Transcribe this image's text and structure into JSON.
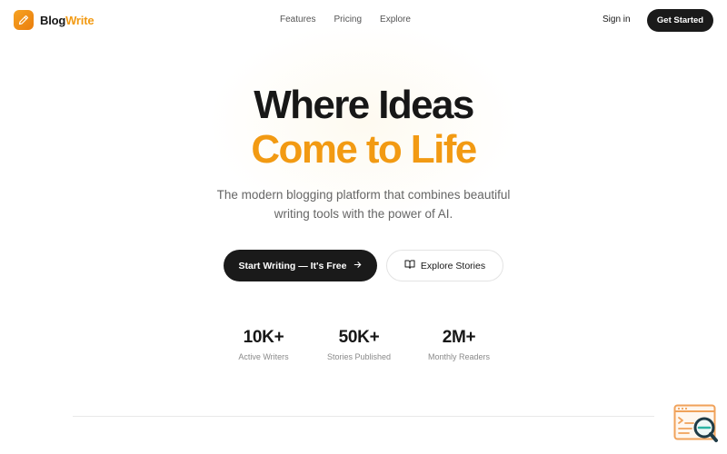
{
  "brand": {
    "name_part1": "Blog",
    "name_part2": "Write",
    "icon": "pencil-icon",
    "accent_color": "#f29a13"
  },
  "nav": {
    "links": [
      "Features",
      "Pricing",
      "Explore"
    ],
    "signin": "Sign in",
    "get_started": "Get Started"
  },
  "hero": {
    "title_line1": "Where Ideas",
    "title_line2": "Come to Life",
    "subtitle_line1": "The modern blogging platform that combines beautiful",
    "subtitle_line2": "writing tools with the power of AI.",
    "cta_primary": "Start Writing — It's Free",
    "cta_primary_icon": "arrow-right-icon",
    "cta_secondary": "Explore Stories",
    "cta_secondary_icon": "book-open-icon"
  },
  "stats": [
    {
      "value": "10K+",
      "label": "Active Writers"
    },
    {
      "value": "50K+",
      "label": "Stories Published"
    },
    {
      "value": "2M+",
      "label": "Monthly Readers"
    }
  ],
  "floating_widget": {
    "icon": "search-document-icon"
  }
}
